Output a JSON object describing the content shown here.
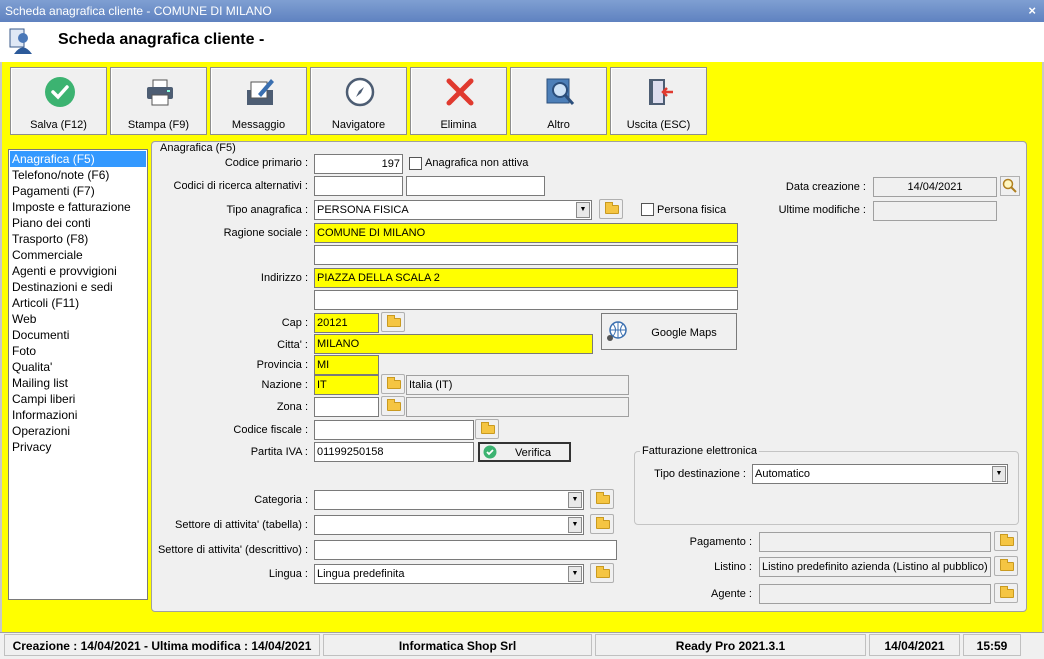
{
  "window": {
    "title": "Scheda anagrafica cliente - COMUNE DI MILANO",
    "close": "×"
  },
  "header": {
    "title": "Scheda anagrafica cliente -"
  },
  "toolbar": {
    "save": "Salva (F12)",
    "print": "Stampa (F9)",
    "message": "Messaggio",
    "navigator": "Navigatore",
    "delete": "Elimina",
    "other": "Altro",
    "exit": "Uscita (ESC)"
  },
  "sidebar": {
    "items": [
      "Anagrafica (F5)",
      "Telefono/note (F6)",
      "Pagamenti (F7)",
      "Imposte e fatturazione",
      "Piano dei conti",
      "Trasporto (F8)",
      "Commerciale",
      "Agenti e provvigioni",
      "Destinazioni e sedi",
      "Articoli (F11)",
      "Web",
      "Documenti",
      "Foto",
      "Qualita'",
      "Mailing list",
      "Campi liberi",
      "Informazioni",
      "Operazioni",
      "Privacy"
    ]
  },
  "form": {
    "group_title": "Anagrafica (F5)",
    "codice_primario_label": "Codice primario :",
    "codice_primario": "197",
    "non_attiva_label": "Anagrafica non attiva",
    "codici_alt_label": "Codici di ricerca alternativi :",
    "codice_alt_1": "",
    "codice_alt_2": "",
    "data_creazione_label": "Data creazione :",
    "data_creazione": "14/04/2021",
    "tipo_label": "Tipo anagrafica :",
    "tipo": "PERSONA FISICA",
    "persona_fisica_label": "Persona fisica",
    "ultime_modifiche_label": "Ultime modifiche :",
    "ultime_modifiche": "",
    "ragione_label": "Ragione sociale :",
    "ragione_1": "COMUNE DI MILANO",
    "ragione_2": "",
    "indirizzo_label": "Indirizzo :",
    "indirizzo_1": "PIAZZA DELLA SCALA 2",
    "indirizzo_2": "",
    "cap_label": "Cap :",
    "cap": "20121",
    "google_maps": "Google Maps",
    "citta_label": "Citta' :",
    "citta": "MILANO",
    "provincia_label": "Provincia :",
    "provincia": "MI",
    "nazione_label": "Nazione :",
    "nazione": "IT",
    "nazione_desc": "Italia (IT)",
    "zona_label": "Zona :",
    "zona": "",
    "zona_desc": "",
    "cf_label": "Codice fiscale :",
    "cf": "",
    "piva_label": "Partita IVA :",
    "piva": "01199250158",
    "verifica": "Verifica",
    "fe_title": "Fatturazione elettronica",
    "tipo_dest_label": "Tipo destinazione :",
    "tipo_dest": "Automatico",
    "categoria_label": "Categoria :",
    "categoria": "",
    "settore_tab_label": "Settore di attivita' (tabella) :",
    "settore_tab": "",
    "settore_desc_label": "Settore di attivita' (descrittivo) :",
    "settore_desc": "",
    "lingua_label": "Lingua :",
    "lingua": "Lingua predefinita",
    "pagamento_label": "Pagamento :",
    "pagamento": "",
    "listino_label": "Listino :",
    "listino": "Listino predefinito azienda (Listino al pubblico)",
    "agente_label": "Agente :",
    "agente": ""
  },
  "status": {
    "created": "Creazione : 14/04/2021 - Ultima modifica : 14/04/2021",
    "company": "Informatica Shop Srl",
    "version": "Ready Pro 2021.3.1",
    "date": "14/04/2021",
    "time": "15:59"
  },
  "colors": {
    "accent_yellow": "#ffff00",
    "selection": "#3399ff",
    "titlebar": "#6a8cc8"
  }
}
